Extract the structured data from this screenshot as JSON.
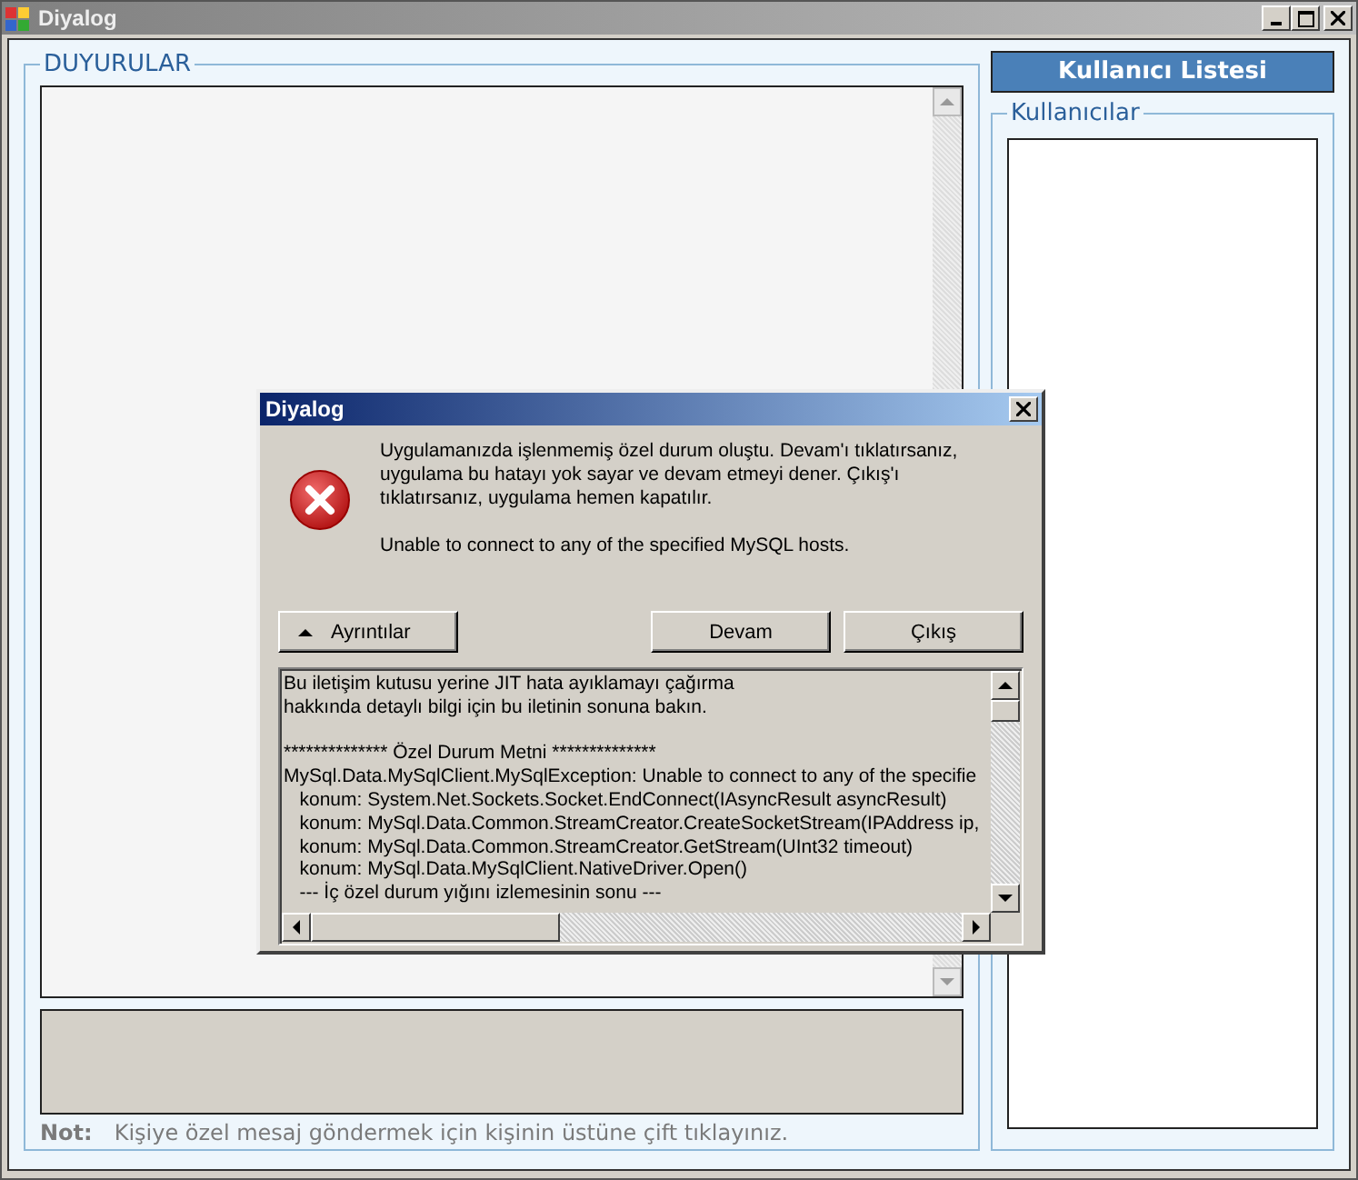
{
  "window": {
    "title": "Diyalog",
    "active": false
  },
  "announcements": {
    "title": "DUYURULAR"
  },
  "note": {
    "label": "Not:",
    "text": "Kişiye özel mesaj göndermek için kişinin üstüne çift tıklayınız."
  },
  "user_list_button": {
    "label": "Kullanıcı Listesi"
  },
  "users": {
    "title": "Kullanıcılar"
  },
  "dialog": {
    "title": "Diyalog",
    "active": true,
    "message": [
      "Uygulamanızda işlenmemiş özel durum oluştu. Devam'ı tıklatırsanız, uygulama bu hatayı yok sayar ve devam etmeyi dener. Çıkış'ı tıklatırsanız, uygulama hemen kapatılır.",
      "Unable to connect to any of the specified MySQL hosts."
    ],
    "buttons": [
      {
        "label": "Ayrıntılar",
        "kind": "details",
        "expanded": true
      },
      {
        "label": "Devam",
        "kind": "action"
      },
      {
        "label": "Çıkış",
        "kind": "action"
      }
    ],
    "details": [
      [
        "Bu iletişim kutusu yerine JIT hata ayıklamayı çağırma",
        "hakkında detaylı bilgi için bu iletinin sonuna bakın."
      ],
      [
        "************** Özel Durum Metni **************",
        "MySql.Data.MySqlClient.MySqlException: Unable to connect to any of the specifie",
        "   konum: System.Net.Sockets.Socket.EndConnect(IAsyncResult asyncResult)",
        "   konum: MySql.Data.Common.StreamCreator.CreateSocketStream(IPAddress ip,",
        "   konum: MySql.Data.Common.StreamCreator.GetStream(UInt32 timeout)",
        "   konum: MySql.Data.MySqlClient.NativeDriver.Open()",
        "   --- İç özel durum yığını izlemesinin sonu ---"
      ]
    ]
  }
}
